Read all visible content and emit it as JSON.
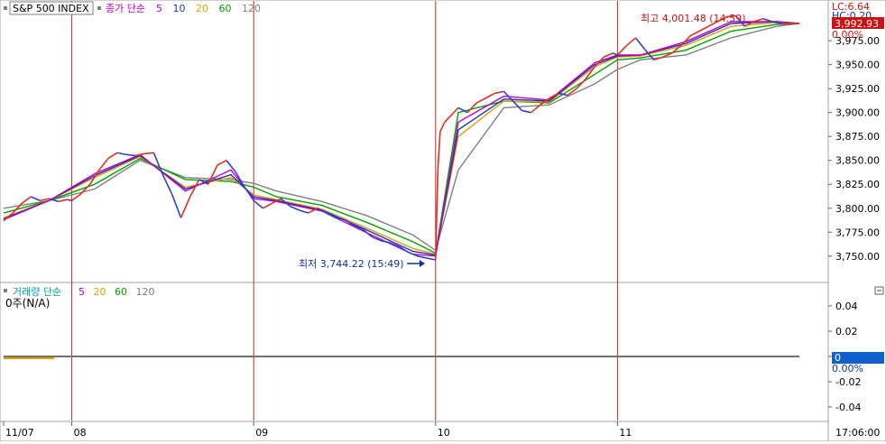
{
  "colors": {
    "price_up": "#e03020",
    "price_down": "#3040d0",
    "ma5": "#c000c0",
    "ma10": "#2030c0",
    "ma20": "#e0a000",
    "ma60": "#00a000",
    "ma120": "#808080",
    "session_line": "#cc2222",
    "last_price_bg": "#cc1111",
    "zero_bg": "#1060d0",
    "annotation_high": "#cc1111",
    "annotation_low": "#1030a0"
  },
  "top_panel": {
    "symbol": "S&P 500 INDEX",
    "legend_prefix": "종가 단순",
    "ma_labels": [
      "5",
      "10",
      "20",
      "60",
      "120"
    ],
    "lc_label": "LC:6.64",
    "hc_label": "HC:0.20",
    "last_price": "3,992.93",
    "change_pct": "0.00%",
    "high_annotation": "최고 4,001.48 (14:59)",
    "low_annotation": "최저 3,744.22 (15:49)"
  },
  "bottom_panel": {
    "legend_prefix": "거래량 단순",
    "ma_labels": [
      "5",
      "20",
      "60",
      "120"
    ],
    "volume_label": "0주(N/A)",
    "zero_label": "0",
    "change_pct": "0.00%"
  },
  "x_axis": {
    "labels": [
      "11/07",
      "08",
      "09",
      "10",
      "11"
    ],
    "time_label": "17:06:00"
  },
  "chart_data": [
    {
      "type": "line",
      "title": "S&P 500 INDEX",
      "x_categories": [
        "11/07",
        "08",
        "09",
        "10",
        "11"
      ],
      "y_ticks": [
        3750,
        3775,
        3800,
        3825,
        3850,
        3875,
        3900,
        3925,
        3950,
        3975
      ],
      "y_tick_labels": [
        "3,750.00",
        "3,775.00",
        "3,800.00",
        "3,825.00",
        "3,850.00",
        "3,875.00",
        "3,900.00",
        "3,925.00",
        "3,950.00",
        "3,975.00"
      ],
      "ylim": [
        3730,
        4010
      ],
      "session_x_index": [
        15,
        55,
        95,
        135
      ],
      "series": [
        {
          "name": "종가",
          "x": [
            0,
            2,
            4,
            6,
            8,
            10,
            12,
            14,
            15,
            17,
            19,
            21,
            23,
            25,
            27,
            29,
            31,
            33,
            35,
            37,
            39,
            41,
            43,
            45,
            47,
            49,
            51,
            53,
            55,
            57,
            59,
            61,
            63,
            65,
            67,
            69,
            71,
            73,
            75,
            77,
            79,
            81,
            83,
            85,
            87,
            89,
            91,
            93,
            95,
            95.5,
            96,
            97,
            98,
            100,
            102,
            104,
            106,
            108,
            110,
            112,
            114,
            116,
            118,
            120,
            122,
            124,
            126,
            128,
            130,
            132,
            134,
            135,
            137,
            139,
            141,
            143,
            145,
            147,
            149,
            151,
            153,
            155,
            157,
            159,
            161,
            163,
            165,
            167,
            169,
            171,
            173,
            175
          ],
          "values": [
            3787,
            3795,
            3805,
            3812,
            3808,
            3810,
            3807,
            3809,
            3808,
            3815,
            3825,
            3840,
            3852,
            3858,
            3856,
            3855,
            3857,
            3858,
            3835,
            3815,
            3790,
            3812,
            3830,
            3825,
            3845,
            3850,
            3838,
            3822,
            3808,
            3800,
            3805,
            3810,
            3802,
            3798,
            3795,
            3800,
            3795,
            3790,
            3788,
            3782,
            3778,
            3770,
            3766,
            3764,
            3760,
            3754,
            3750,
            3748,
            3746,
            3840,
            3880,
            3890,
            3895,
            3905,
            3900,
            3910,
            3915,
            3920,
            3922,
            3912,
            3902,
            3900,
            3908,
            3915,
            3920,
            3918,
            3925,
            3935,
            3948,
            3958,
            3962,
            3960,
            3970,
            3978,
            3966,
            3955,
            3958,
            3962,
            3970,
            3980,
            3985,
            3990,
            3995,
            4000,
            4001,
            3990,
            3995,
            3998,
            3995,
            3993,
            3993,
            3993
          ]
        },
        {
          "name": "5",
          "x": [
            0,
            10,
            20,
            30,
            40,
            50,
            55,
            60,
            70,
            80,
            90,
            95,
            100,
            110,
            120,
            130,
            135,
            140,
            150,
            160,
            170,
            175
          ],
          "values": [
            3788,
            3808,
            3836,
            3856,
            3818,
            3840,
            3810,
            3807,
            3797,
            3774,
            3752,
            3750,
            3890,
            3917,
            3913,
            3952,
            3960,
            3960,
            3974,
            3995,
            3995,
            3993
          ]
        },
        {
          "name": "10",
          "x": [
            0,
            10,
            20,
            30,
            40,
            50,
            55,
            60,
            70,
            80,
            90,
            95,
            100,
            110,
            120,
            130,
            135,
            140,
            150,
            160,
            170,
            175
          ],
          "values": [
            3789,
            3808,
            3834,
            3855,
            3820,
            3835,
            3812,
            3808,
            3798,
            3777,
            3755,
            3751,
            3882,
            3914,
            3912,
            3950,
            3959,
            3960,
            3972,
            3993,
            3995,
            3993
          ]
        },
        {
          "name": "20",
          "x": [
            0,
            10,
            20,
            30,
            40,
            50,
            55,
            60,
            70,
            80,
            90,
            95,
            100,
            110,
            120,
            130,
            135,
            140,
            150,
            160,
            170,
            175
          ],
          "values": [
            3790,
            3808,
            3832,
            3854,
            3822,
            3832,
            3814,
            3809,
            3799,
            3779,
            3758,
            3752,
            3875,
            3912,
            3911,
            3948,
            3958,
            3959,
            3970,
            3990,
            3994,
            3993
          ]
        },
        {
          "name": "60",
          "x": [
            0,
            10,
            20,
            30,
            40,
            50,
            55,
            60,
            70,
            80,
            90,
            95,
            100,
            110,
            120,
            130,
            135,
            140,
            150,
            160,
            170,
            175
          ],
          "values": [
            3795,
            3808,
            3825,
            3852,
            3830,
            3828,
            3822,
            3812,
            3803,
            3785,
            3765,
            3753,
            3900,
            3912,
            3910,
            3940,
            3955,
            3957,
            3965,
            3985,
            3992,
            3993
          ]
        },
        {
          "name": "120",
          "x": [
            0,
            10,
            20,
            30,
            40,
            50,
            55,
            60,
            70,
            80,
            90,
            95,
            100,
            110,
            120,
            130,
            135,
            140,
            150,
            160,
            170,
            175
          ],
          "values": [
            3800,
            3808,
            3820,
            3850,
            3832,
            3830,
            3826,
            3818,
            3807,
            3792,
            3772,
            3756,
            3840,
            3905,
            3908,
            3930,
            3945,
            3955,
            3960,
            3978,
            3990,
            3993
          ]
        }
      ]
    },
    {
      "type": "bar",
      "title": "거래량",
      "y_ticks": [
        0.04,
        0.02,
        0,
        -0.02,
        -0.04
      ],
      "y_tick_labels": [
        "0.04",
        "0.02",
        "0",
        "-0.02",
        "-0.04"
      ],
      "ylim": [
        -0.05,
        0.05
      ],
      "series": [
        {
          "name": "거래량",
          "x": [
            0,
            175
          ],
          "values": [
            0,
            0
          ]
        }
      ]
    }
  ]
}
